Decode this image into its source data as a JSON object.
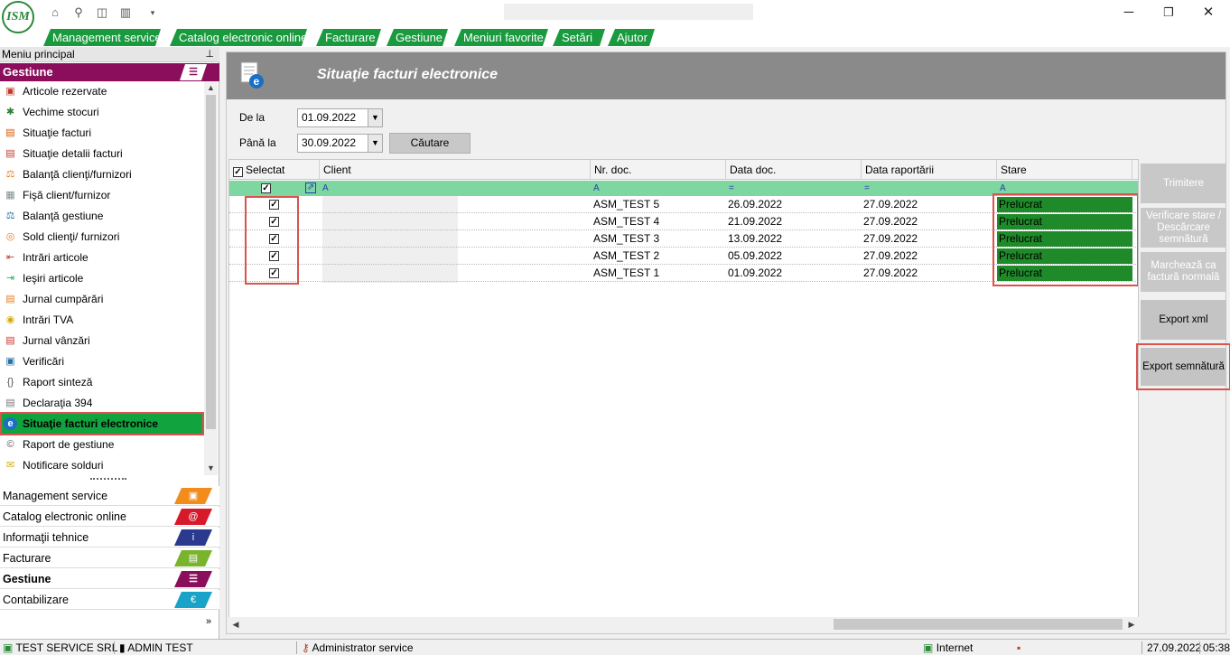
{
  "titlebar": {
    "logo_text": "ISM",
    "title_text": ""
  },
  "menu": [
    {
      "label": "Management service"
    },
    {
      "label": "Catalog electronic online"
    },
    {
      "label": "Facturare"
    },
    {
      "label": "Gestiune"
    },
    {
      "label": "Meniuri favorite"
    },
    {
      "label": "Setări"
    },
    {
      "label": "Ajutor"
    }
  ],
  "left_panel": {
    "header": "Meniu principal",
    "section": "Gestiune",
    "items": [
      {
        "label": "Articole rezervate"
      },
      {
        "label": "Vechime stocuri"
      },
      {
        "label": "Situaţie facturi"
      },
      {
        "label": "Situaţie detalii facturi"
      },
      {
        "label": "Balanţă clienţi/furnizori"
      },
      {
        "label": "Fişă client/furnizor"
      },
      {
        "label": "Balanţă gestiune"
      },
      {
        "label": "Sold clienţi/ furnizori"
      },
      {
        "label": "Intrări articole"
      },
      {
        "label": "Ieşiri articole"
      },
      {
        "label": "Jurnal cumpărări"
      },
      {
        "label": "Intrări TVA"
      },
      {
        "label": "Jurnal vânzări"
      },
      {
        "label": "Verificări"
      },
      {
        "label": "Raport sinteză"
      },
      {
        "label": "Declaraţia 394"
      },
      {
        "label": "Situaţie facturi electronice"
      },
      {
        "label": "Raport de gestiune"
      },
      {
        "label": "Notificare solduri"
      }
    ],
    "tabs": [
      {
        "label": "Management service",
        "color": "#f28c1c"
      },
      {
        "label": "Catalog electronic online",
        "color": "#d6192b"
      },
      {
        "label": "Informaţii tehnice",
        "color": "#2b3a8f"
      },
      {
        "label": "Facturare",
        "color": "#7ab32e"
      },
      {
        "label": "Gestiune",
        "color": "#8b0e5c"
      },
      {
        "label": "Contabilizare",
        "color": "#1aa3c9"
      }
    ]
  },
  "main": {
    "title": "Situaţie facturi electronice",
    "filters": {
      "from_label": "De la",
      "from_value": "01.09.2022",
      "to_label": "Până la",
      "to_value": "30.09.2022",
      "search_button": "Căutare"
    },
    "grid": {
      "columns": [
        "Selectat",
        "Client",
        "Nr. doc.",
        "Data doc.",
        "Data raportării",
        "Stare"
      ],
      "filter_ops": [
        "A",
        "A",
        "=",
        "=",
        "A"
      ],
      "rows": [
        {
          "selected": true,
          "client": "",
          "nr_doc": "ASM_TEST 5",
          "data_doc": "26.09.2022",
          "data_raportarii": "27.09.2022",
          "stare": "Prelucrat"
        },
        {
          "selected": true,
          "client": "",
          "nr_doc": "ASM_TEST 4",
          "data_doc": "21.09.2022",
          "data_raportarii": "27.09.2022",
          "stare": "Prelucrat"
        },
        {
          "selected": true,
          "client": "",
          "nr_doc": "ASM_TEST 3",
          "data_doc": "13.09.2022",
          "data_raportarii": "27.09.2022",
          "stare": "Prelucrat"
        },
        {
          "selected": true,
          "client": "",
          "nr_doc": "ASM_TEST 2",
          "data_doc": "05.09.2022",
          "data_raportarii": "27.09.2022",
          "stare": "Prelucrat"
        },
        {
          "selected": true,
          "client": "",
          "nr_doc": "ASM_TEST 1",
          "data_doc": "01.09.2022",
          "data_raportarii": "27.09.2022",
          "stare": "Prelucrat"
        }
      ]
    },
    "actions": [
      {
        "label": "Trimitere",
        "enabled": false
      },
      {
        "label": "Verificare stare / Descărcare semnătură",
        "enabled": false
      },
      {
        "label": "Marchează ca factură normală",
        "enabled": false
      },
      {
        "label": "Export xml",
        "enabled": true
      },
      {
        "label": "Export semnătură",
        "enabled": true
      }
    ]
  },
  "statusbar": {
    "company": "TEST SERVICE SRL",
    "user": "ADMIN TEST",
    "role": "Administrator service",
    "connection": "Internet",
    "date": "27.09.2022",
    "time": "05:38"
  },
  "colors": {
    "accent_green": "#1a9a3e",
    "section_magenta": "#8b0e5c",
    "status_green": "#1f8a2a",
    "highlight_red": "#d9534f"
  }
}
